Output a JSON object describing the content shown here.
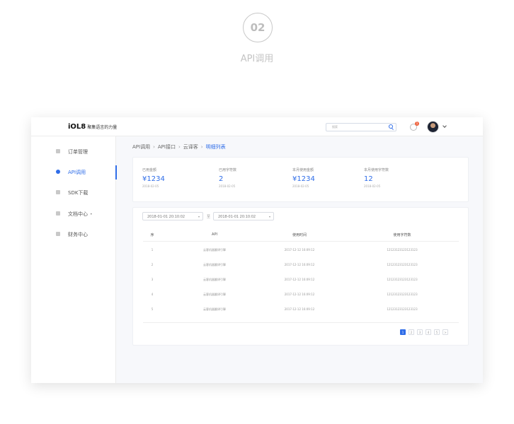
{
  "step_number": "02",
  "section_title": "API调用",
  "header": {
    "logo": "iOL8",
    "slogan": "聚集语言的力量",
    "search_placeholder": "搜索",
    "notification_count": "1"
  },
  "sidebar": {
    "items": [
      {
        "label": "订单管理",
        "icon": "shop-icon",
        "active": false
      },
      {
        "label": "API调用",
        "icon": "gear-icon",
        "active": true
      },
      {
        "label": "SDK下载",
        "icon": "cloud-icon",
        "active": false
      },
      {
        "label": "文档中心",
        "icon": "folder-icon",
        "active": false,
        "extra": "•"
      },
      {
        "label": "财务中心",
        "icon": "coin-icon",
        "active": false
      }
    ]
  },
  "breadcrumb": [
    "API调用",
    "API接口",
    "云译客",
    "明细列表"
  ],
  "stats": [
    {
      "label": "已用金额",
      "value": "¥1234",
      "date": "2018-02-05"
    },
    {
      "label": "已用字符数",
      "value": "2",
      "date": "2018-02-05"
    },
    {
      "label": "本月使用金额",
      "value": "¥1234",
      "date": "2018-02-05"
    },
    {
      "label": "本月使用字符数",
      "value": "12",
      "date": "2018-02-05"
    }
  ],
  "filters": {
    "start": "2018-01-01   20:10:02",
    "separator": "至",
    "end": "2018-01-01   20:10:02"
  },
  "table": {
    "columns": [
      "序",
      "API",
      "使用时间",
      "使用字符数"
    ],
    "rows": [
      [
        "1",
        "云客机器翻译引擎",
        "2017-12-12 16:09:12",
        "12123123123123123"
      ],
      [
        "2",
        "云客机器翻译引擎",
        "2017-12-12 16:09:12",
        "12123123123123123"
      ],
      [
        "3",
        "云客机器翻译引擎",
        "2017-12-12 16:09:12",
        "12123123123123123"
      ],
      [
        "4",
        "云客机器翻译引擎",
        "2017-12-12 16:09:12",
        "12123123123123123"
      ],
      [
        "5",
        "云客机器翻译引擎",
        "2017-12-12 16:09:12",
        "12123123123123123"
      ]
    ]
  },
  "pagination": {
    "pages": [
      "1",
      "2",
      "3",
      "4",
      "5"
    ],
    "next": ">",
    "current": "1"
  },
  "colors": {
    "accent": "#2f6de8",
    "badge": "#f0633e"
  }
}
